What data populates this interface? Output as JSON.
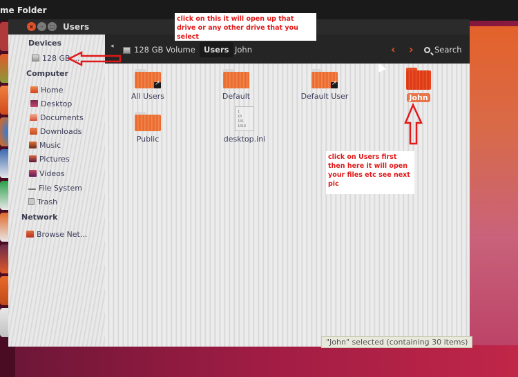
{
  "top_panel": {
    "title": "me Folder"
  },
  "window": {
    "title": "Users",
    "close_label": "x",
    "minimize_label": "–",
    "maximize_label": "□"
  },
  "toolbar": {
    "back_arrow": "◂",
    "breadcrumbs": [
      {
        "label": "128 GB Volume",
        "icon": "drive-icon"
      },
      {
        "label": "Users",
        "active": true
      },
      {
        "label": "John"
      }
    ],
    "prev_label": "‹",
    "next_label": "›",
    "search_label": "Search"
  },
  "sidebar": {
    "sections": [
      {
        "heading": "Devices",
        "items": [
          {
            "label": "128 GB ...",
            "icon": "drive-icon"
          }
        ]
      },
      {
        "heading": "Computer",
        "items": [
          {
            "label": "Home",
            "icon": "home-icon"
          },
          {
            "label": "Desktop",
            "icon": "desktop-icon"
          },
          {
            "label": "Documents",
            "icon": "documents-icon"
          },
          {
            "label": "Downloads",
            "icon": "downloads-icon"
          },
          {
            "label": "Music",
            "icon": "music-icon"
          },
          {
            "label": "Pictures",
            "icon": "pictures-icon"
          },
          {
            "label": "Videos",
            "icon": "videos-icon"
          },
          {
            "label": "File System",
            "icon": "filesystem-icon"
          },
          {
            "label": "Trash",
            "icon": "trash-icon"
          }
        ]
      },
      {
        "heading": "Network",
        "items": [
          {
            "label": "Browse Net...",
            "icon": "network-icon"
          }
        ]
      }
    ]
  },
  "files": [
    {
      "name": "All Users",
      "type": "folder-link"
    },
    {
      "name": "Default",
      "type": "folder"
    },
    {
      "name": "Default User",
      "type": "folder-link"
    },
    {
      "name": "John",
      "type": "folder",
      "selected": true
    },
    {
      "name": "Public",
      "type": "folder"
    },
    {
      "name": "desktop.ini",
      "type": "text-file",
      "preview": [
        "1",
        "10",
        "101",
        "1010"
      ]
    }
  ],
  "status": {
    "text": "\"John\" selected (containing 30 items)"
  },
  "annotations": {
    "top": "click on this it will open up that drive or any other drive that you select",
    "side": "click on Users first then here it will open your files etc see next pic",
    "color": "#e01818"
  },
  "colors": {
    "accent": "#e8652c",
    "panel": "#252525"
  }
}
